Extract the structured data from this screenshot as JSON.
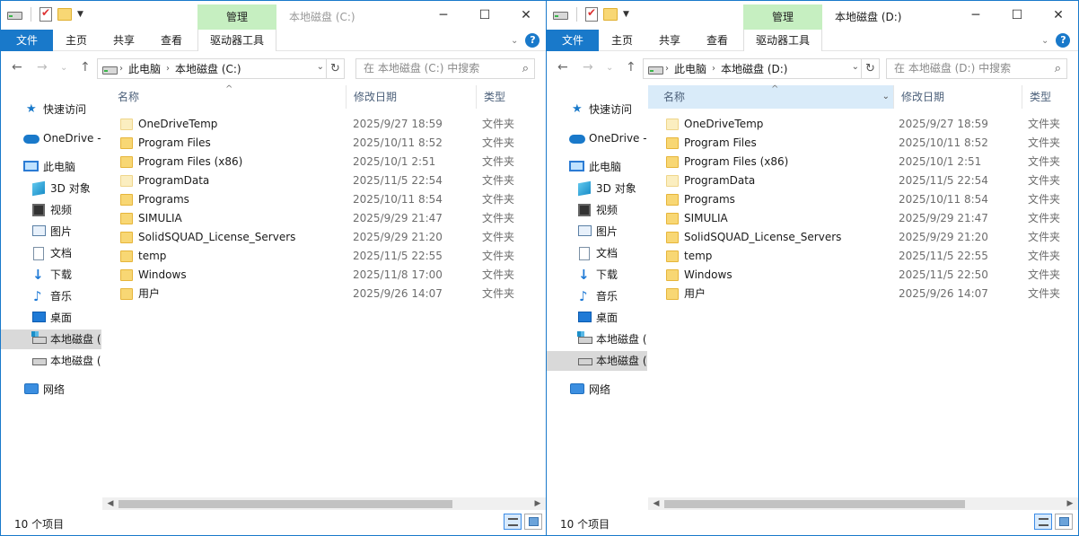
{
  "windows": [
    {
      "id": "c",
      "title": "本地磁盘 (C:)",
      "manage_tab": "管理",
      "ribbon_tabs": [
        "文件",
        "主页",
        "共享",
        "查看",
        "驱动器工具"
      ],
      "address": [
        "此电脑",
        "本地磁盘 (C:)"
      ],
      "search_placeholder": "在 本地磁盘 (C:) 中搜索",
      "columns": [
        "名称",
        "修改日期",
        "类型"
      ],
      "status_count": "10 个项目",
      "files": [
        {
          "name": "OneDriveTemp",
          "date": "2025/9/27 18:59",
          "type": "文件夹",
          "light": true
        },
        {
          "name": "Program Files",
          "date": "2025/10/11 8:52",
          "type": "文件夹",
          "light": false
        },
        {
          "name": "Program Files (x86)",
          "date": "2025/10/1 2:51",
          "type": "文件夹",
          "light": false
        },
        {
          "name": "ProgramData",
          "date": "2025/11/5 22:54",
          "type": "文件夹",
          "light": true
        },
        {
          "name": "Programs",
          "date": "2025/10/11 8:54",
          "type": "文件夹",
          "light": false
        },
        {
          "name": "SIMULIA",
          "date": "2025/9/29 21:47",
          "type": "文件夹",
          "light": false
        },
        {
          "name": "SolidSQUAD_License_Servers",
          "date": "2025/9/29 21:20",
          "type": "文件夹",
          "light": false
        },
        {
          "name": "temp",
          "date": "2025/11/5 22:55",
          "type": "文件夹",
          "light": false
        },
        {
          "name": "Windows",
          "date": "2025/11/8 17:00",
          "type": "文件夹",
          "light": false
        },
        {
          "name": "用户",
          "date": "2025/9/26 14:07",
          "type": "文件夹",
          "light": false
        }
      ]
    },
    {
      "id": "d",
      "title": "本地磁盘 (D:)",
      "manage_tab": "管理",
      "ribbon_tabs": [
        "文件",
        "主页",
        "共享",
        "查看",
        "驱动器工具"
      ],
      "address": [
        "此电脑",
        "本地磁盘 (D:)"
      ],
      "search_placeholder": "在 本地磁盘 (D:) 中搜索",
      "columns": [
        "名称",
        "修改日期",
        "类型"
      ],
      "status_count": "10 个项目",
      "files": [
        {
          "name": "OneDriveTemp",
          "date": "2025/9/27 18:59",
          "type": "文件夹",
          "light": true
        },
        {
          "name": "Program Files",
          "date": "2025/10/11 8:52",
          "type": "文件夹",
          "light": false
        },
        {
          "name": "Program Files (x86)",
          "date": "2025/10/1 2:51",
          "type": "文件夹",
          "light": false
        },
        {
          "name": "ProgramData",
          "date": "2025/11/5 22:54",
          "type": "文件夹",
          "light": true
        },
        {
          "name": "Programs",
          "date": "2025/10/11 8:54",
          "type": "文件夹",
          "light": false
        },
        {
          "name": "SIMULIA",
          "date": "2025/9/29 21:47",
          "type": "文件夹",
          "light": false
        },
        {
          "name": "SolidSQUAD_License_Servers",
          "date": "2025/9/29 21:20",
          "type": "文件夹",
          "light": false
        },
        {
          "name": "temp",
          "date": "2025/11/5 22:55",
          "type": "文件夹",
          "light": false
        },
        {
          "name": "Windows",
          "date": "2025/11/5 22:50",
          "type": "文件夹",
          "light": false
        },
        {
          "name": "用户",
          "date": "2025/9/26 14:07",
          "type": "文件夹",
          "light": false
        }
      ]
    }
  ],
  "nav_items": [
    {
      "label": "快速访问",
      "icon": "star-icon"
    },
    {
      "label": "OneDrive -",
      "icon": "cloud-icon"
    },
    {
      "label": "此电脑",
      "icon": "pc-icon"
    },
    {
      "label": "3D 对象",
      "icon": "3d-objects-icon"
    },
    {
      "label": "视频",
      "icon": "video-icon"
    },
    {
      "label": "图片",
      "icon": "pictures-icon"
    },
    {
      "label": "文档",
      "icon": "documents-icon"
    },
    {
      "label": "下载",
      "icon": "download-icon"
    },
    {
      "label": "音乐",
      "icon": "music-icon"
    },
    {
      "label": "桌面",
      "icon": "desktop-icon"
    },
    {
      "label": "本地磁盘 (",
      "icon": "system-drive-icon"
    },
    {
      "label": "本地磁盘 (",
      "icon": "drive-icon"
    },
    {
      "label": "网络",
      "icon": "network-icon"
    }
  ],
  "colors": {
    "accent": "#1979ca",
    "manage_tab": "#c6efc1",
    "selected": "#d9d9d9",
    "header_highlight": "#d9ebf9"
  }
}
